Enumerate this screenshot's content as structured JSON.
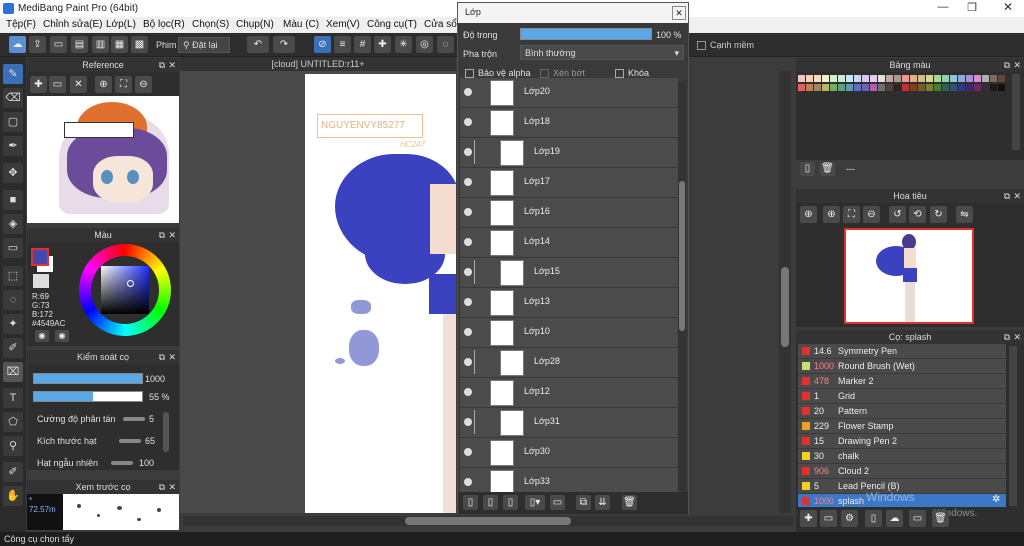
{
  "window": {
    "title": "MediBang Paint Pro (64bit)"
  },
  "menu": [
    "Tệp(F)",
    "Chỉnh sửa(E)",
    "Lớp(L)",
    "Bộ lọc(R)",
    "Chọn(S)",
    "Chụp(N)",
    "Màu (C)",
    "Xem(V)",
    "Công cụ(T)",
    "Cửa sổ(W)"
  ],
  "toolbar": {
    "phim_label": "Phim",
    "reset_label": "Đặt lại",
    "smooth_label": "Cạnh mềm"
  },
  "reference": {
    "title": "Reference"
  },
  "color_panel": {
    "title": "Màu",
    "r": "R:69",
    "g": "G:73",
    "b": "B:172",
    "hex": "#4549AC",
    "fg": "#4549ac"
  },
  "brush_control": {
    "title": "Kiểm soát cọ",
    "size_value": "1000",
    "size_fill": 1.0,
    "opacity_value": "55 %",
    "opacity_fill": 0.55,
    "scatter_label": "Cường độ phân tán",
    "scatter_value": "5",
    "particle_label": "Kích thước hạt",
    "particle_value": "65",
    "random_label": "Hạt ngẫu nhiên",
    "random_value": "100"
  },
  "preview": {
    "title": "Xem trước cọ",
    "text": "72.57m"
  },
  "canvas": {
    "tab_title": "[cloud] UNTITLED:r11+",
    "watermark_name": "NGUYENVY85277",
    "watermark_small": "HC247"
  },
  "layer_panel": {
    "title": "Lớp",
    "opacity_label": "Độ trong",
    "opacity_value": "100 %",
    "opacity_fill": 1.0,
    "blend_label": "Pha trộn",
    "blend_value": "Bình thường",
    "protect_alpha": "Bảo vệ alpha",
    "clip": "Xén bớt",
    "lock": "Khóa",
    "layers": [
      {
        "name": "Lớp20",
        "clip": false
      },
      {
        "name": "Lớp18",
        "clip": false
      },
      {
        "name": "Lớp19",
        "clip": true
      },
      {
        "name": "Lớp17",
        "clip": false
      },
      {
        "name": "Lớp16",
        "clip": false
      },
      {
        "name": "Lớp14",
        "clip": false
      },
      {
        "name": "Lớp15",
        "clip": true
      },
      {
        "name": "Lớp13",
        "clip": false
      },
      {
        "name": "Lớp10",
        "clip": false
      },
      {
        "name": "Lớp28",
        "clip": true
      },
      {
        "name": "Lớp12",
        "clip": false
      },
      {
        "name": "Lớp31",
        "clip": true
      },
      {
        "name": "Lớp30",
        "clip": false
      },
      {
        "name": "Lớp33",
        "clip": false
      }
    ]
  },
  "palette": {
    "title": "Bảng màu",
    "set_name": "---",
    "swatches": [
      "#f2c5c5",
      "#f5d0b5",
      "#f0e0c0",
      "#f6f0c8",
      "#d8efc8",
      "#c8eed8",
      "#c8e8f0",
      "#c8d8f4",
      "#d4c8f0",
      "#ecc8ee",
      "#e0e0e0",
      "#c0a8a0",
      "#a89890",
      "#f09898",
      "#e4b080",
      "#d0c090",
      "#d8d890",
      "#a8d890",
      "#90d0b0",
      "#90c8d8",
      "#90a8e0",
      "#a890d8",
      "#d890d0",
      "#b0b0b0",
      "#806860",
      "#604840",
      "#e06060",
      "#c08050",
      "#a08860",
      "#b8b860",
      "#70b060",
      "#60a080",
      "#6098b0",
      "#6070c0",
      "#7060b0",
      "#b060a8",
      "#707070",
      "#504040",
      "#302020",
      "#c03030",
      "#804020",
      "#706030",
      "#808030",
      "#408030",
      "#306050",
      "#305070",
      "#303880",
      "#402870",
      "#702860",
      "#303030",
      "#201818",
      "#101010"
    ]
  },
  "navigator": {
    "title": "Hoa tiêu"
  },
  "brush_panel": {
    "title": "Cọ: splash",
    "brushes": [
      {
        "size": "14.6",
        "name": "Symmetry Pen",
        "color": "#e03030"
      },
      {
        "size": "1000",
        "name": "Round Brush (Wet)",
        "color": "#c8e070"
      },
      {
        "size": "478",
        "name": "Marker 2",
        "color": "#e03030"
      },
      {
        "size": "1",
        "name": "Grid",
        "color": "#e03030"
      },
      {
        "size": "20",
        "name": "Pattern",
        "color": "#e03030"
      },
      {
        "size": "229",
        "name": "Flower Stamp",
        "color": "#f0a020"
      },
      {
        "size": "15",
        "name": "Drawing Pen 2",
        "color": "#e03030"
      },
      {
        "size": "30",
        "name": "chalk",
        "color": "#f0d020"
      },
      {
        "size": "906",
        "name": "Cloud 2",
        "color": "#e03030"
      },
      {
        "size": "5",
        "name": "Lead Pencil (B)",
        "color": "#f0d020"
      },
      {
        "size": "1000",
        "name": "splash",
        "color": "#e03030"
      }
    ],
    "watermark1": "Windows",
    "watermark2": "Windows."
  },
  "status": {
    "text": "Công cụ chọn tẩy"
  }
}
